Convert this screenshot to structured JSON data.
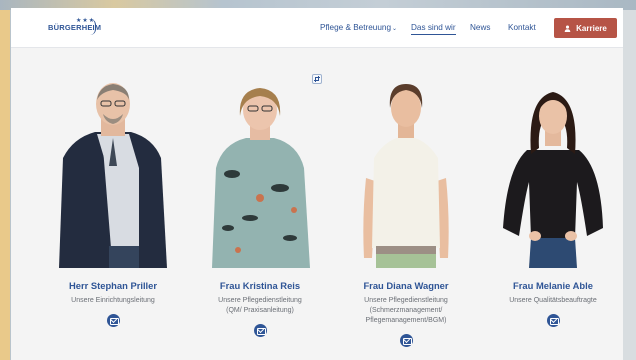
{
  "site": {
    "logo_text": "BÜRGERHEIM",
    "logo_stars": "★★★"
  },
  "nav": {
    "items": [
      {
        "label": "Pflege & Betreuung",
        "has_dropdown": true,
        "active": false
      },
      {
        "label": "Das sind wir",
        "has_dropdown": false,
        "active": true
      },
      {
        "label": "News",
        "has_dropdown": false,
        "active": false
      },
      {
        "label": "Kontakt",
        "has_dropdown": false,
        "active": false
      }
    ],
    "career_button": "Karriere",
    "dropdown_glyph": "⌄"
  },
  "people": [
    {
      "name": "Herr Stephan Priller",
      "role": "Unsere Einrichtungsleitung",
      "colors": {
        "jacket": "#232c3f",
        "shirt": "#d8dce2",
        "hair": "#8a7f74",
        "skin": "#e8c2a8"
      }
    },
    {
      "name": "Frau Kristina Reis",
      "role": "Unsere Pflegedienstleitung\n(QM/ Praxisanleitung)",
      "colors": {
        "top": "#93b3b0",
        "hair": "#a67f4d",
        "skin": "#ecc5ad"
      }
    },
    {
      "name": "Frau Diana Wagner",
      "role": "Unsere Pflegedienstleitung\n(Schmerzmanagement/\nPflegemanagement/BGM)",
      "colors": {
        "top": "#f3f1e8",
        "pants": "#a6c297",
        "hair": "#5a3d2c",
        "skin": "#e9bea0"
      }
    },
    {
      "name": "Frau Melanie Able",
      "role": "Unsere Qualitätsbeauftragte",
      "colors": {
        "top": "#1c1a1d",
        "pants": "#2d4a72",
        "hair": "#2b1a14",
        "skin": "#eac2a7"
      }
    }
  ],
  "colors": {
    "brand": "#2f5596",
    "career": "#b65446"
  }
}
